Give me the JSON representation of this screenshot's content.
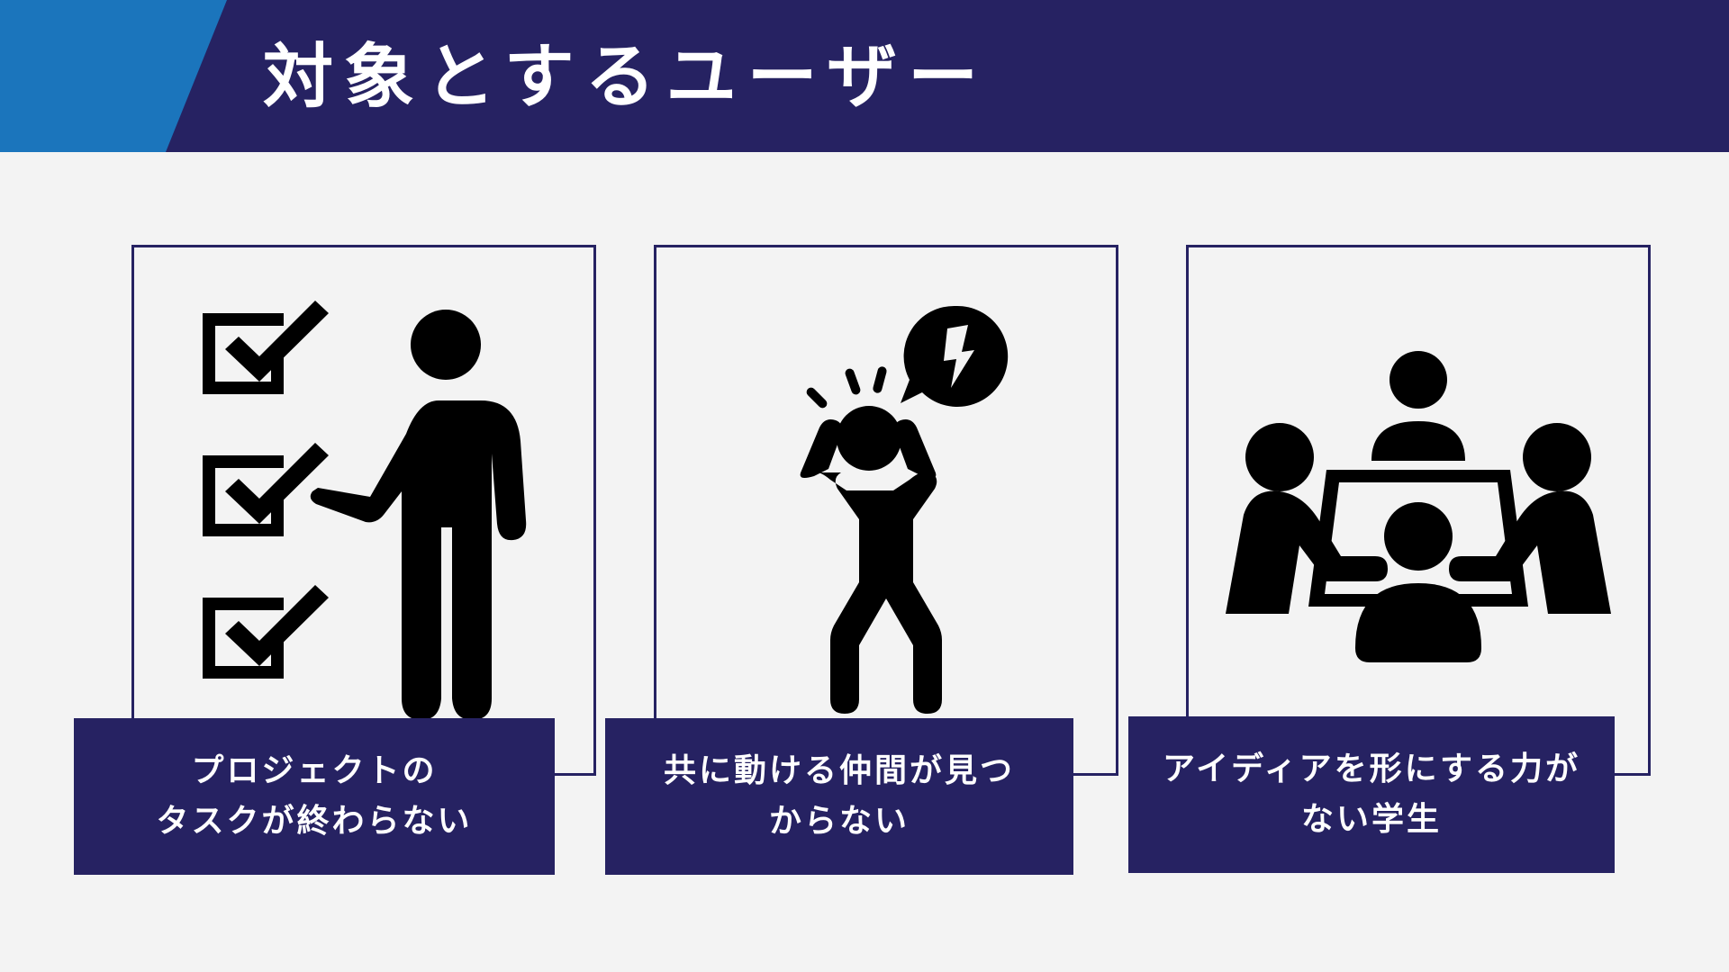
{
  "header": {
    "title": "対象とするユーザー",
    "background_color": "#262262",
    "accent_color": "#1b75bc"
  },
  "cards": [
    {
      "icon": "person-checklist-icon",
      "caption_line1": "プロジェクトの",
      "caption_line2": "タスクが終わらない"
    },
    {
      "icon": "stressed-person-icon",
      "caption_line1": "共に動ける仲間が見つ",
      "caption_line2": "からない"
    },
    {
      "icon": "team-meeting-icon",
      "caption_line1": "アイディアを形にする力が",
      "caption_line2": "ない学生"
    }
  ],
  "colors": {
    "page_background": "#f3f3f3",
    "card_border": "#262262",
    "caption_background": "#262262",
    "caption_text": "#ffffff",
    "icon": "#000000"
  }
}
